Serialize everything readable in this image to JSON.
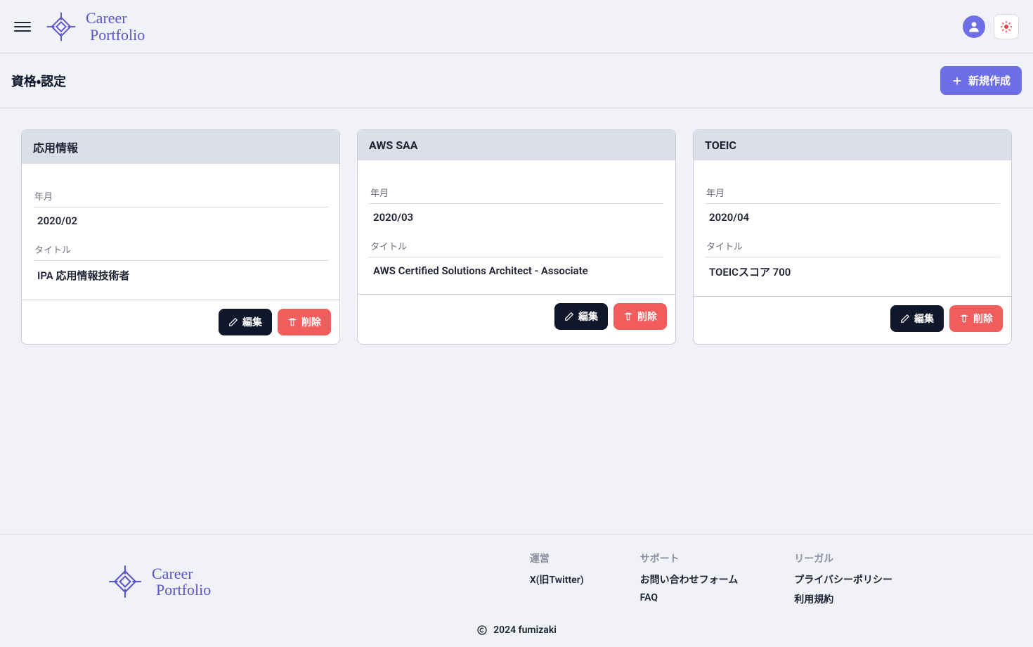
{
  "brand": {
    "line1": "Career",
    "line2": "Portfolio"
  },
  "page": {
    "title": "資格・認定",
    "new_label": "新規作成"
  },
  "labels": {
    "date": "年月",
    "title": "タイトル",
    "edit": "編集",
    "delete": "削除"
  },
  "cards": [
    {
      "header": "応用情報",
      "date": "2020/02",
      "title": "IPA 応用情報技術者"
    },
    {
      "header": "AWS SAA",
      "date": "2020/03",
      "title": "AWS Certified Solutions Architect - Associate"
    },
    {
      "header": "TOEIC",
      "date": "2020/04",
      "title": "TOEICスコア 700"
    }
  ],
  "footer": {
    "col1_title": "運営",
    "col1_links": [
      "X(旧Twitter)"
    ],
    "col2_title": "サポート",
    "col2_links": [
      "お問い合わせフォーム",
      "FAQ"
    ],
    "col3_title": "リーガル",
    "col3_links": [
      "プライバシーポリシー",
      "利用規約"
    ],
    "copyright": "2024 fumizaki"
  }
}
